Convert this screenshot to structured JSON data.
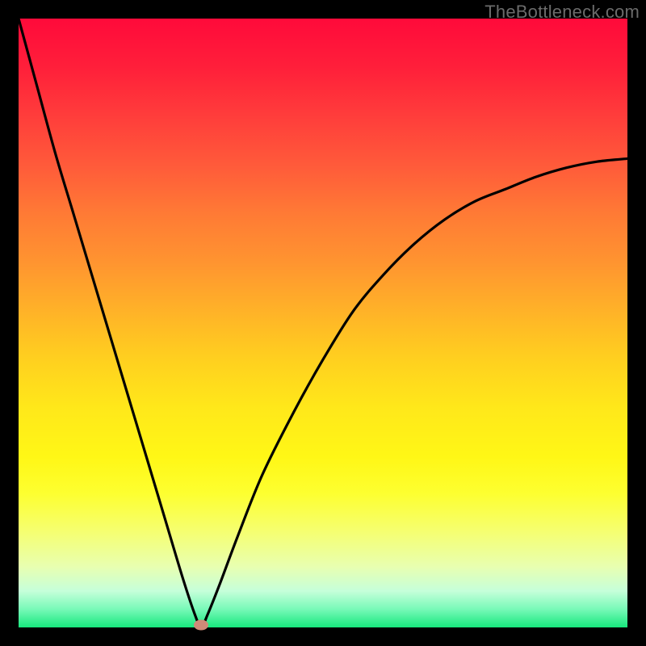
{
  "watermark": "TheBottleneck.com",
  "chart_data": {
    "type": "line",
    "title": "",
    "xlabel": "",
    "ylabel": "",
    "xlim": [
      0,
      100
    ],
    "ylim": [
      0,
      100
    ],
    "grid": false,
    "series": [
      {
        "name": "curve",
        "x": [
          0,
          3,
          6,
          9,
          12,
          15,
          18,
          21,
          24,
          27,
          29,
          30,
          31,
          33,
          36,
          40,
          45,
          50,
          55,
          60,
          65,
          70,
          75,
          80,
          85,
          90,
          95,
          100
        ],
        "values": [
          100,
          89,
          78,
          68,
          58,
          48,
          38,
          28,
          18,
          8,
          2,
          0,
          2,
          7,
          15,
          25,
          35,
          44,
          52,
          58,
          63,
          67,
          70,
          72,
          74,
          75.5,
          76.5,
          77
        ]
      }
    ],
    "marker": {
      "x": 30,
      "y": 0.4
    },
    "colors": {
      "curve": "#000000",
      "marker": "#cf8a78",
      "gradient_top": "#ff0a3a",
      "gradient_bottom": "#17e87d"
    }
  }
}
